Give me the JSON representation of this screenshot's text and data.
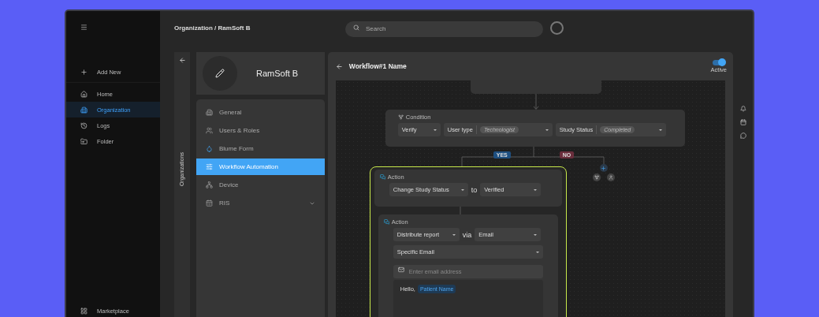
{
  "sidebar": {
    "primary": {
      "label": "Add New"
    },
    "items": [
      {
        "label": "Home",
        "selected": false
      },
      {
        "label": "Organization",
        "selected": true
      },
      {
        "label": "Logs",
        "selected": false
      },
      {
        "label": "Folder",
        "selected": false
      }
    ],
    "footer": {
      "label": "Marketplace"
    }
  },
  "topbar": {
    "breadcrumb": "Organization / RamSoft B",
    "search": {
      "placeholder": "Search"
    }
  },
  "organizations_panel": {
    "label": "Organizations"
  },
  "organization": {
    "name": "RamSoft B",
    "menu": [
      {
        "label": "General",
        "selected": false,
        "expandable": false
      },
      {
        "label": "Users & Roles",
        "selected": false,
        "expandable": false
      },
      {
        "label": "Blume Form",
        "selected": false,
        "expandable": false
      },
      {
        "label": "Workflow Automation",
        "selected": true,
        "expandable": false
      },
      {
        "label": "Device",
        "selected": false,
        "expandable": false
      },
      {
        "label": "RIS",
        "selected": false,
        "expandable": true
      }
    ]
  },
  "workflow": {
    "title": "Workflow#1 Name",
    "toggle": {
      "on": true,
      "label": "Active"
    },
    "condition": {
      "title": "Condition",
      "fields": [
        {
          "value": "Verify"
        },
        {
          "label": "User type",
          "chip": "Technologist"
        },
        {
          "label": "Study Status",
          "chip": "Completed"
        }
      ]
    },
    "branches": [
      {
        "label": "YES",
        "color": "#1e4f80"
      },
      {
        "label": "NO",
        "color": "#6a2e3c"
      }
    ],
    "action_1": {
      "title": "Action",
      "field": "Change Study Status",
      "joiner": "to",
      "value": "Verified"
    },
    "action_2": {
      "title": "Action",
      "field": "Distribute report",
      "joiner": "via",
      "value": "Email",
      "recipient": "Specific Email",
      "email": {
        "placeholder": "Enter email address"
      },
      "message": {
        "greeting": "Hello,",
        "tag": "Patient Name"
      }
    }
  }
}
